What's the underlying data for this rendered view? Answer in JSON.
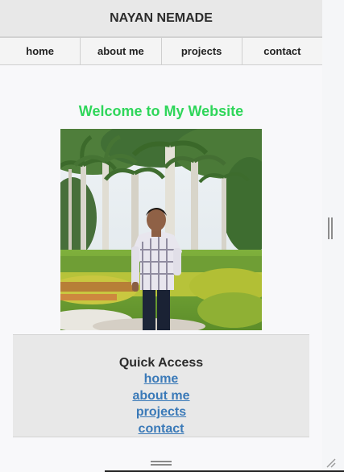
{
  "site": {
    "title": "NAYAN NEMADE"
  },
  "nav": {
    "items": [
      {
        "label": "home"
      },
      {
        "label": "about me"
      },
      {
        "label": "projects"
      },
      {
        "label": "contact"
      }
    ]
  },
  "main": {
    "heading": "Welcome to My Website",
    "heading_color": "#2fd65a"
  },
  "quick_access": {
    "title": "Quick Access",
    "links": [
      {
        "label": "home"
      },
      {
        "label": "about me"
      },
      {
        "label": "projects"
      },
      {
        "label": "contact"
      }
    ],
    "link_color": "#3b7ab8"
  },
  "icons": {
    "vertical_grip": "vertical-resize-grip-icon",
    "horizontal_grip": "horizontal-resize-grip-icon",
    "corner_grip": "resize-corner-icon"
  }
}
